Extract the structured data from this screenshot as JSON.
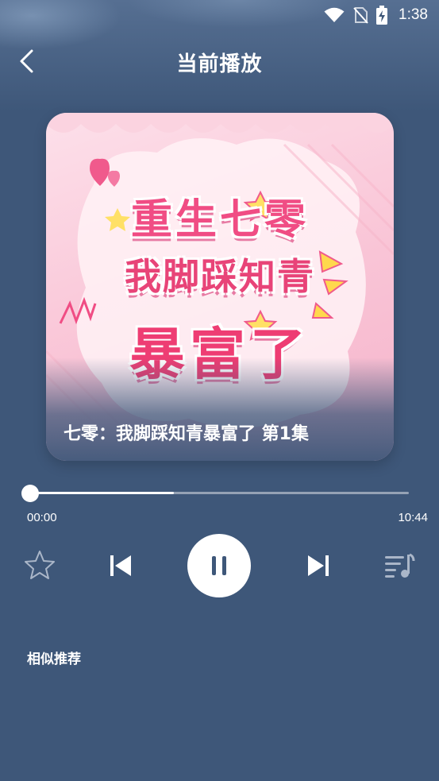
{
  "status": {
    "time": "1:38"
  },
  "header": {
    "title": "当前播放"
  },
  "cover": {
    "line1": "重生七零",
    "line2": "我脚踩知青",
    "line3": "暴富了",
    "caption": "七零：我脚踩知青暴富了 第1集"
  },
  "player": {
    "current_time": "00:00",
    "total_time": "10:44",
    "progress": 0.0,
    "buffered": 0.38
  },
  "section": {
    "similar_title": "相似推荐"
  },
  "colors": {
    "background": "#3e5779",
    "accent": "#ffffff",
    "cover_pink": "#f04d84"
  }
}
